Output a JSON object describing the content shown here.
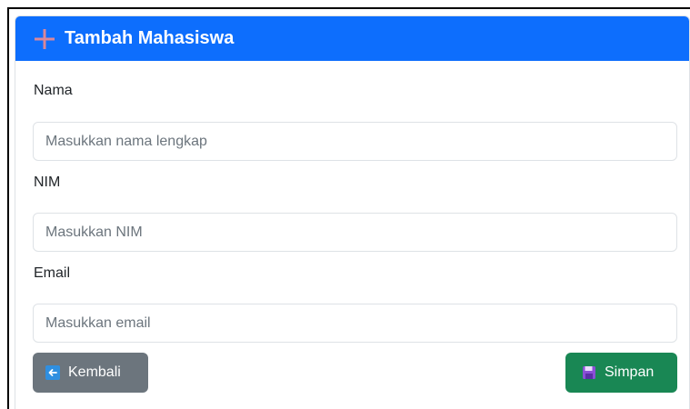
{
  "header": {
    "title": "Tambah Mahasiswa",
    "icon": "plus-icon",
    "background_color": "#0d6efd"
  },
  "form": {
    "nama": {
      "label": "Nama",
      "placeholder": "Masukkan nama lengkap",
      "value": ""
    },
    "nim": {
      "label": "NIM",
      "placeholder": "Masukkan NIM",
      "value": ""
    },
    "email": {
      "label": "Email",
      "placeholder": "Masukkan email",
      "value": ""
    }
  },
  "actions": {
    "back": {
      "label": "Kembali",
      "icon": "arrow-left-icon",
      "color": "#6c757d"
    },
    "save": {
      "label": "Simpan",
      "icon": "floppy-disk-icon",
      "color": "#198754"
    }
  }
}
